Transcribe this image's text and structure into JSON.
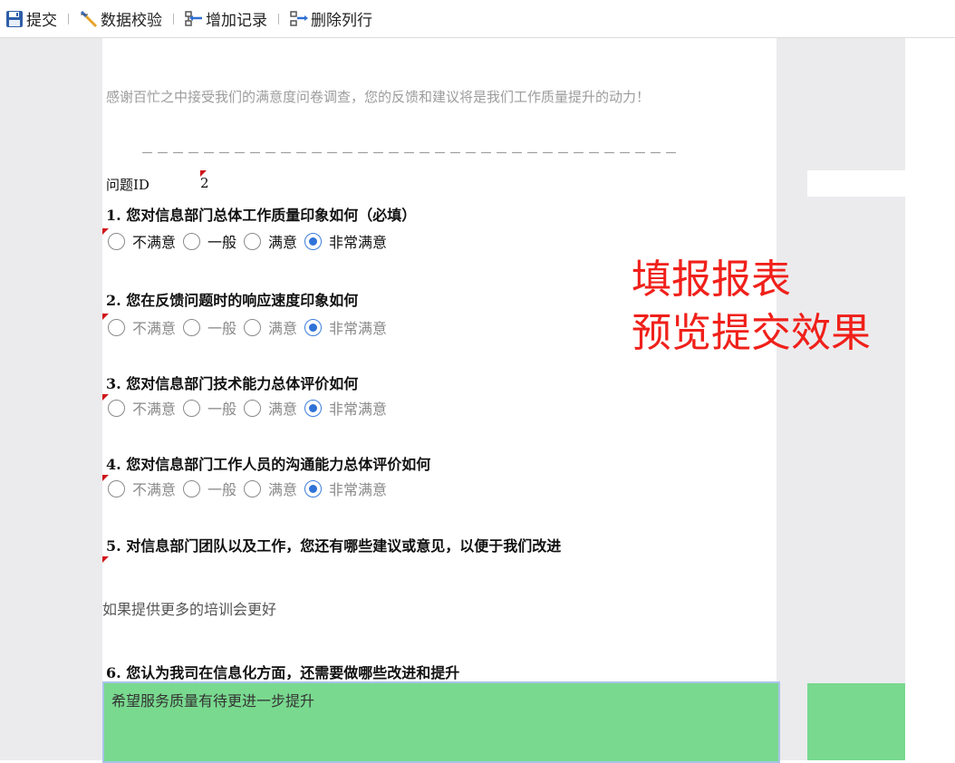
{
  "toolbar": {
    "submit": "提交",
    "validate": "数据校验",
    "add_record": "增加记录",
    "delete_row": "删除列行"
  },
  "form": {
    "intro": "感谢百忙之中接受我们的满意度问卷调查，您的反馈和建议将是我们工作质量提升的动力！",
    "divider": "－－－－－－－－－－－－－－－－－－－－－－－－－－－－－－－－－－－",
    "qid_label": "问题ID",
    "qid_value": "2",
    "options": [
      "不满意",
      "一般",
      "满意",
      "非常满意"
    ],
    "questions": [
      {
        "title": "1. 您对信息部门总体工作质量印象如何（必填）",
        "selected": "非常满意"
      },
      {
        "title": "2. 您在反馈问题时的响应速度印象如何",
        "selected": "非常满意"
      },
      {
        "title": "3. 您对信息部门技术能力总体评价如何",
        "selected": "非常满意"
      },
      {
        "title": "4. 您对信息部门工作人员的沟通能力总体评价如何",
        "selected": "非常满意"
      },
      {
        "title": "5. 对信息部门团队以及工作，您还有哪些建议或意见，以便于我们改进",
        "answer": "如果提供更多的培训会更好"
      },
      {
        "title": "6. 您认为我司在信息化方面，还需要做哪些改进和提升",
        "answer": "希望服务质量有待更进一步提升"
      }
    ]
  },
  "overlay": {
    "line1": "填报报表",
    "line2": "预览提交效果"
  },
  "colors": {
    "accent": "#f0201a",
    "highlight": "#79d98f",
    "radio_selected": "#2f73d8",
    "marker": "#d0141b"
  },
  "icons": [
    "save-icon",
    "check-wand-icon",
    "add-record-icon",
    "delete-row-icon"
  ]
}
